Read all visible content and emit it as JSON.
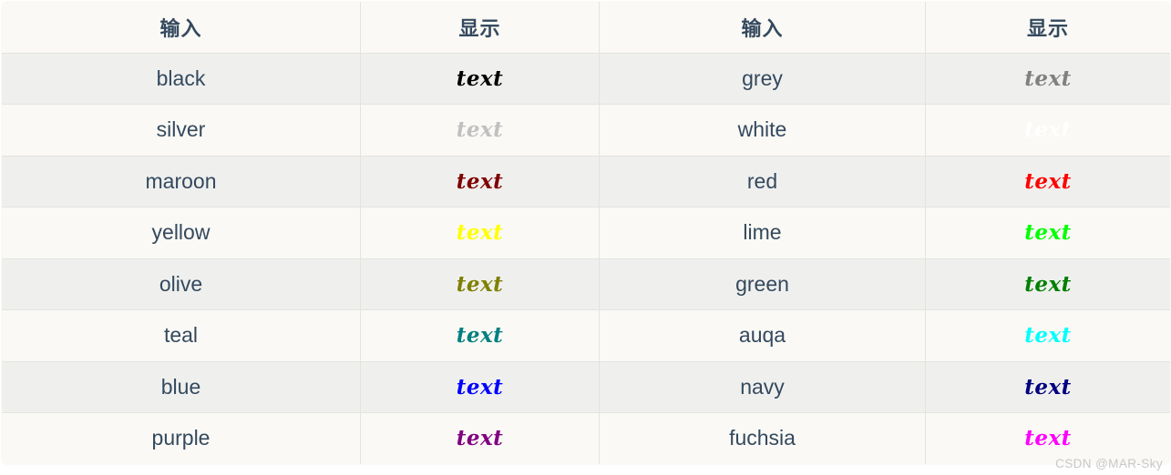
{
  "table": {
    "headers": [
      "输入",
      "显示",
      "输入",
      "显示"
    ],
    "sample_text": "text",
    "rows": [
      {
        "left": {
          "name": "black",
          "swatch": "#000000"
        },
        "right": {
          "name": "grey",
          "swatch": "#808080"
        }
      },
      {
        "left": {
          "name": "silver",
          "swatch": "#c0c0c0"
        },
        "right": {
          "name": "white",
          "swatch": "#ffffff"
        }
      },
      {
        "left": {
          "name": "maroon",
          "swatch": "#800000"
        },
        "right": {
          "name": "red",
          "swatch": "#ff0000"
        }
      },
      {
        "left": {
          "name": "yellow",
          "swatch": "#ffff00"
        },
        "right": {
          "name": "lime",
          "swatch": "#00ff00"
        }
      },
      {
        "left": {
          "name": "olive",
          "swatch": "#808000"
        },
        "right": {
          "name": "green",
          "swatch": "#008000"
        }
      },
      {
        "left": {
          "name": "teal",
          "swatch": "#008080"
        },
        "right": {
          "name": "auqa",
          "swatch": "#00ffff"
        }
      },
      {
        "left": {
          "name": "blue",
          "swatch": "#0000ff"
        },
        "right": {
          "name": "navy",
          "swatch": "#000080"
        }
      },
      {
        "left": {
          "name": "purple",
          "swatch": "#800080"
        },
        "right": {
          "name": "fuchsia",
          "swatch": "#ff00ff"
        }
      }
    ]
  },
  "watermark": "CSDN @MAR-Sky",
  "theme": {
    "row_odd_bg": "#eff0ee",
    "row_even_bg": "#faf9f5",
    "header_bg": "#faf9f5",
    "border": "#e3e4e0",
    "label_color": "#34495e"
  }
}
